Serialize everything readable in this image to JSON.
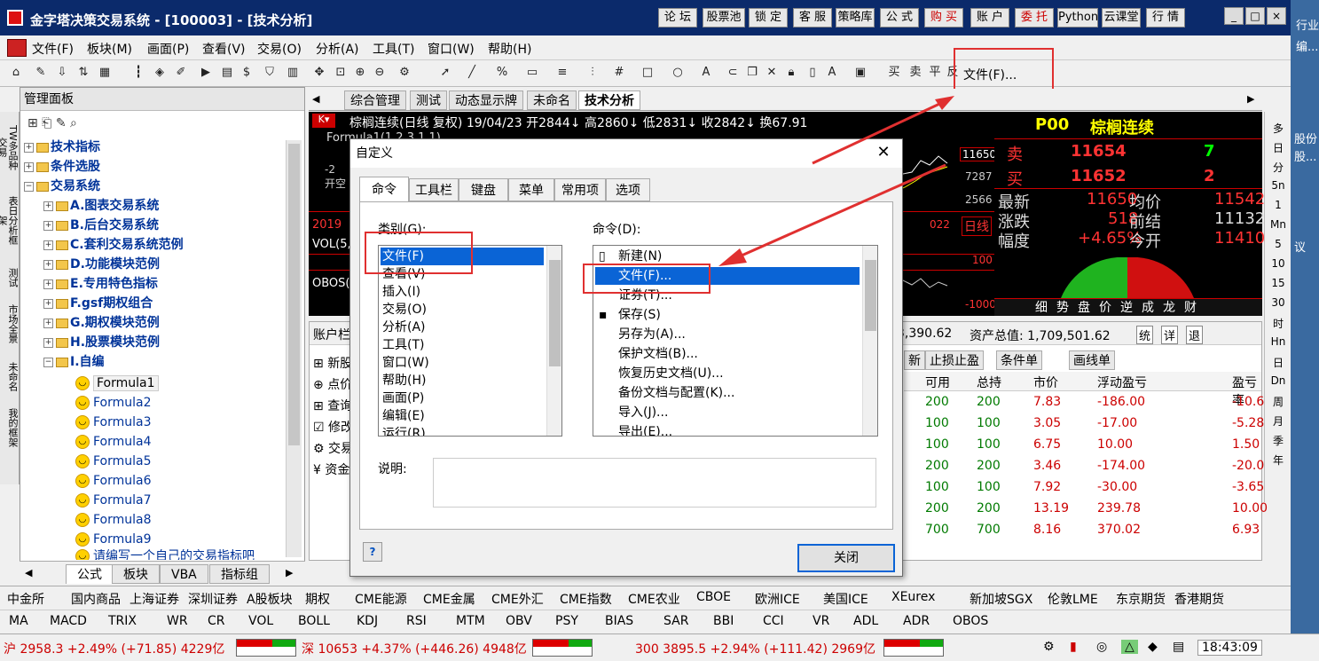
{
  "window": {
    "title": "金字塔决策交易系统 - [100003] - [技术分析]",
    "title_buttons": [
      "论 坛",
      "股票池",
      "锁 定",
      "客 服",
      "策略库",
      "公 式",
      "购 买",
      "账 户",
      "委 托",
      "Python",
      "云课堂",
      "行 情"
    ],
    "controls": [
      "_",
      "□",
      "×"
    ]
  },
  "menubar": [
    "文件(F)",
    "板块(M)",
    "画面(P)",
    "查看(V)",
    "交易(O)",
    "分析(A)",
    "工具(T)",
    "窗口(W)",
    "帮助(H)"
  ],
  "toolbar": {
    "file_label": "文件(F)..."
  },
  "panel": {
    "title": "管理面板",
    "vertical_tabs": [
      "TW多品种交易",
      "表日分析框架",
      "测试",
      "市场全景",
      "未命名",
      "我的框架"
    ],
    "tree": [
      {
        "label": "技术指标",
        "level": 0
      },
      {
        "label": "条件选股",
        "level": 0
      },
      {
        "label": "交易系统",
        "level": 0
      },
      {
        "label": "A.图表交易系统",
        "level": 1
      },
      {
        "label": "B.后台交易系统",
        "level": 1
      },
      {
        "label": "C.套利交易系统范例",
        "level": 1
      },
      {
        "label": "D.功能模块范例",
        "level": 1
      },
      {
        "label": "E.专用特色指标",
        "level": 1
      },
      {
        "label": "F.gsf期权组合",
        "level": 1
      },
      {
        "label": "G.期权模块范例",
        "level": 1
      },
      {
        "label": "H.股票模块范例",
        "level": 1
      },
      {
        "label": "I.自编",
        "level": 1
      }
    ],
    "formulas": [
      "Formula1",
      "Formula2",
      "Formula3",
      "Formula4",
      "Formula5",
      "Formula6",
      "Formula7",
      "Formula8",
      "Formula9",
      "请编写一个自己的交易指标吧"
    ],
    "tabs": [
      "公式",
      "板块",
      "VBA",
      "指标组"
    ]
  },
  "chart_tabs": [
    "综合管理",
    "测试",
    "动态显示牌",
    "未命名",
    "技术分析"
  ],
  "chart": {
    "header": "棕榈连续(日线 复权) 19/04/23 开2844↓ 高2860↓ 低2831↓ 收2842↓ 换67.91",
    "formula_line": "Formula1(1,2,3,1,1)",
    "vol_label": "VOL(5,",
    "obos_label": "OBOS(",
    "price_a": "11650",
    "price_b": "7287",
    "price_c": "2566",
    "right_a": "100",
    "right_b": "-1000",
    "date_a": "2019",
    "date_b": "022",
    "open_label": "开空",
    "minus": "-2",
    "daily": "日线"
  },
  "quote": {
    "code": "P00",
    "name": "棕榈连续",
    "sell_label": "卖",
    "sell_price": "11654",
    "sell_vol": "7",
    "buy_label": "买",
    "buy_price": "11652",
    "buy_vol": "2",
    "latest_label": "最新",
    "latest": "11650",
    "avg_label": "均价",
    "avg": "11542",
    "chg_label": "涨跌",
    "chg": "518",
    "prev_label": "前结",
    "prev": "11132",
    "pct_label": "幅度",
    "pct": "+4.65%",
    "open_label": "今开",
    "open": "11410",
    "tabs": [
      "细",
      "势",
      "盘",
      "价",
      "逆",
      "成",
      "龙",
      "财"
    ]
  },
  "account": {
    "title": "账户栏",
    "assets_a": "3,390.62",
    "total_assets": "资产总值: 1,709,501.62",
    "btns": [
      "统",
      "详",
      "退"
    ],
    "actions": [
      "新股",
      "点价",
      "查询",
      "修改",
      "交易",
      "资金"
    ],
    "subtabs": [
      "新",
      "止损止盈",
      "条件单",
      "画线单"
    ],
    "columns": [
      "可用",
      "总持",
      "市价",
      "浮动盈亏",
      "盈亏率"
    ],
    "rows": [
      [
        "200",
        "200",
        "7.83",
        "-186.00",
        "-10.6"
      ],
      [
        "100",
        "100",
        "3.05",
        "-17.00",
        "-5.28"
      ],
      [
        "100",
        "100",
        "6.75",
        "10.00",
        "1.50"
      ],
      [
        "200",
        "200",
        "3.46",
        "-174.00",
        "-20.0"
      ],
      [
        "100",
        "100",
        "7.92",
        "-30.00",
        "-3.65"
      ],
      [
        "200",
        "200",
        "13.19",
        "239.78",
        "10.00"
      ],
      [
        "700",
        "700",
        "8.16",
        "370.02",
        "6.93"
      ]
    ]
  },
  "exchanges": [
    "中金所",
    "国内商品",
    "上海证券",
    "深圳证券",
    "A股板块",
    "期权",
    "CME能源",
    "CME金属",
    "CME外汇",
    "CME指数",
    "CME农业",
    "CBOE",
    "欧洲ICE",
    "美国ICE",
    "XEurex",
    "新加坡SGX",
    "伦敦LME",
    "东京期货",
    "香港期货"
  ],
  "indicators": [
    "MA",
    "MACD",
    "TRIX",
    "WR",
    "CR",
    "VOL",
    "BOLL",
    "KDJ",
    "RSI",
    "MTM",
    "OBV",
    "PSY",
    "BIAS",
    "SAR",
    "BBI",
    "CCI",
    "VR",
    "ADL",
    "ADR",
    "OBOS"
  ],
  "status": {
    "sh": "沪 2958.3 +2.49% (+71.85) 4229亿",
    "sz": "深 10653 +4.37% (+446.26) 4948亿",
    "hs300": "300 3895.5 +2.94% (+111.42) 2969亿",
    "time": "18:43:09"
  },
  "right_tools": [
    "多",
    "日",
    "分",
    "5n",
    "1",
    "Mn",
    "5",
    "10",
    "15",
    "30",
    "时",
    "Hn",
    "日",
    "Dn",
    "周",
    "月",
    "季",
    "年"
  ],
  "right_edge": [
    "行业",
    "编...",
    "股份",
    "股...",
    "议"
  ],
  "dialog": {
    "title": "自定义",
    "tabs": [
      "命令",
      "工具栏",
      "键盘",
      "菜单",
      "常用项",
      "选项"
    ],
    "category_label": "类别(G):",
    "command_label": "命令(D):",
    "desc_label": "说明:",
    "close": "关闭",
    "categories": [
      "文件(F)",
      "查看(V)",
      "插入(I)",
      "交易(O)",
      "分析(A)",
      "工具(T)",
      "窗口(W)",
      "帮助(H)",
      "画面(P)",
      "编辑(E)",
      "运行(R)"
    ],
    "commands": [
      "新建(N)",
      "文件(F)...",
      "证券(T)...",
      "保存(S)",
      "另存为(A)...",
      "保护文档(B)...",
      "恢复历史文档(U)...",
      "备份文档与配置(K)...",
      "导入(J)...",
      "导出(E)..."
    ]
  },
  "colors": {
    "title": "#0b2a6b",
    "red": "#e03030",
    "select": "#0a64d6"
  }
}
